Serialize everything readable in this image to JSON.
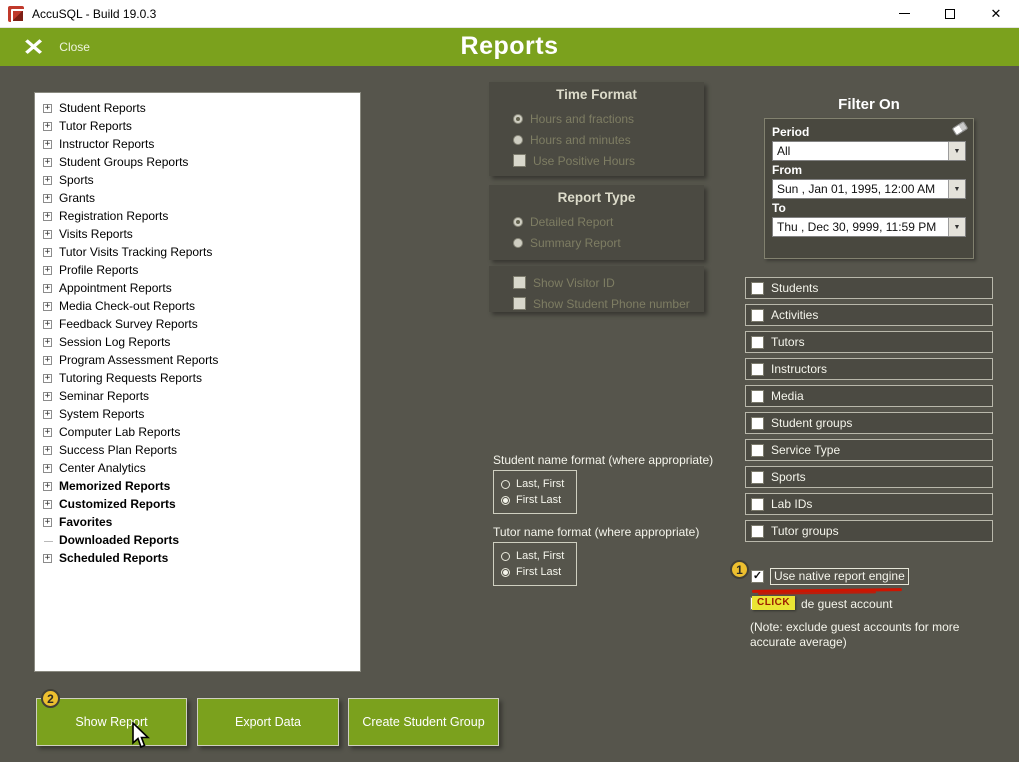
{
  "window": {
    "title": "AccuSQL - Build 19.0.3"
  },
  "icons": {
    "header_close": "✕",
    "window_close": "✕",
    "dropdown_arrow": "▼",
    "checkmark": "✓"
  },
  "colors": {
    "accent_green": "#7ba11d",
    "background": "#56554c",
    "panel": "#4b4a42",
    "annotation_yellow": "#edbf2f",
    "annotation_red": "#ce1400",
    "click_badge_yellow": "#eae534"
  },
  "header": {
    "close_label": "Close",
    "title": "Reports"
  },
  "tree": {
    "items": [
      {
        "label": "Student Reports",
        "bold": false,
        "expander": "+"
      },
      {
        "label": "Tutor Reports",
        "bold": false,
        "expander": "+"
      },
      {
        "label": "Instructor Reports",
        "bold": false,
        "expander": "+"
      },
      {
        "label": "Student Groups Reports",
        "bold": false,
        "expander": "+"
      },
      {
        "label": "Sports",
        "bold": false,
        "expander": "+"
      },
      {
        "label": "Grants",
        "bold": false,
        "expander": "+"
      },
      {
        "label": "Registration Reports",
        "bold": false,
        "expander": "+"
      },
      {
        "label": "Visits Reports",
        "bold": false,
        "expander": "+"
      },
      {
        "label": "Tutor Visits Tracking Reports",
        "bold": false,
        "expander": "+"
      },
      {
        "label": "Profile Reports",
        "bold": false,
        "expander": "+"
      },
      {
        "label": "Appointment Reports",
        "bold": false,
        "expander": "+"
      },
      {
        "label": "Media Check-out Reports",
        "bold": false,
        "expander": "+"
      },
      {
        "label": "Feedback Survey Reports",
        "bold": false,
        "expander": "+"
      },
      {
        "label": "Session Log Reports",
        "bold": false,
        "expander": "+"
      },
      {
        "label": "Program Assessment Reports",
        "bold": false,
        "expander": "+"
      },
      {
        "label": "Tutoring Requests Reports",
        "bold": false,
        "expander": "+"
      },
      {
        "label": "Seminar Reports",
        "bold": false,
        "expander": "+"
      },
      {
        "label": "System Reports",
        "bold": false,
        "expander": "+"
      },
      {
        "label": "Computer Lab Reports",
        "bold": false,
        "expander": "+"
      },
      {
        "label": "Success Plan Reports",
        "bold": false,
        "expander": "+"
      },
      {
        "label": "Center Analytics",
        "bold": false,
        "expander": "+"
      },
      {
        "label": "Memorized Reports",
        "bold": true,
        "expander": "+"
      },
      {
        "label": "Customized Reports",
        "bold": true,
        "expander": "+"
      },
      {
        "label": "Favorites",
        "bold": true,
        "expander": "+"
      },
      {
        "label": "Downloaded Reports",
        "bold": true,
        "expander": ""
      },
      {
        "label": "Scheduled Reports",
        "bold": true,
        "expander": "+"
      }
    ]
  },
  "time_format": {
    "title": "Time Format",
    "options": [
      "Hours and fractions",
      "Hours and minutes"
    ],
    "positive_hours": "Use Positive Hours"
  },
  "report_type": {
    "title": "Report Type",
    "options": [
      "Detailed Report",
      "Summary Report"
    ]
  },
  "visitor_options": {
    "show_visitor_id": "Show Visitor ID",
    "show_phone": "Show Student Phone number"
  },
  "student_name_format": {
    "label": "Student name format (where appropriate)",
    "options": [
      "Last, First",
      "First Last"
    ]
  },
  "tutor_name_format": {
    "label": "Tutor name format (where appropriate)",
    "options": [
      "Last, First",
      "First Last"
    ]
  },
  "filter": {
    "title": "Filter On",
    "period_label": "Period",
    "period_value": "All",
    "from_label": "From",
    "from_value": "Sun , Jan 01, 1995, 12:00 AM",
    "to_label": "To",
    "to_value": "Thu , Dec 30, 9999, 11:59 PM",
    "categories": [
      "Students",
      "Activities",
      "Tutors",
      "Instructors",
      "Media",
      "Student groups",
      "Service Type",
      "Sports",
      "Lab IDs",
      "Tutor groups"
    ]
  },
  "extras": {
    "native_engine_label": "Use native report engine",
    "click_badge": "CLICK",
    "guest_label": "de guest account",
    "note": "(Note: exclude guest accounts for more accurate average)"
  },
  "actions": {
    "show_report": "Show Report",
    "export_data": "Export Data",
    "create_student_group": "Create Student Group"
  },
  "annotations": {
    "step1": "1",
    "step2": "2"
  }
}
